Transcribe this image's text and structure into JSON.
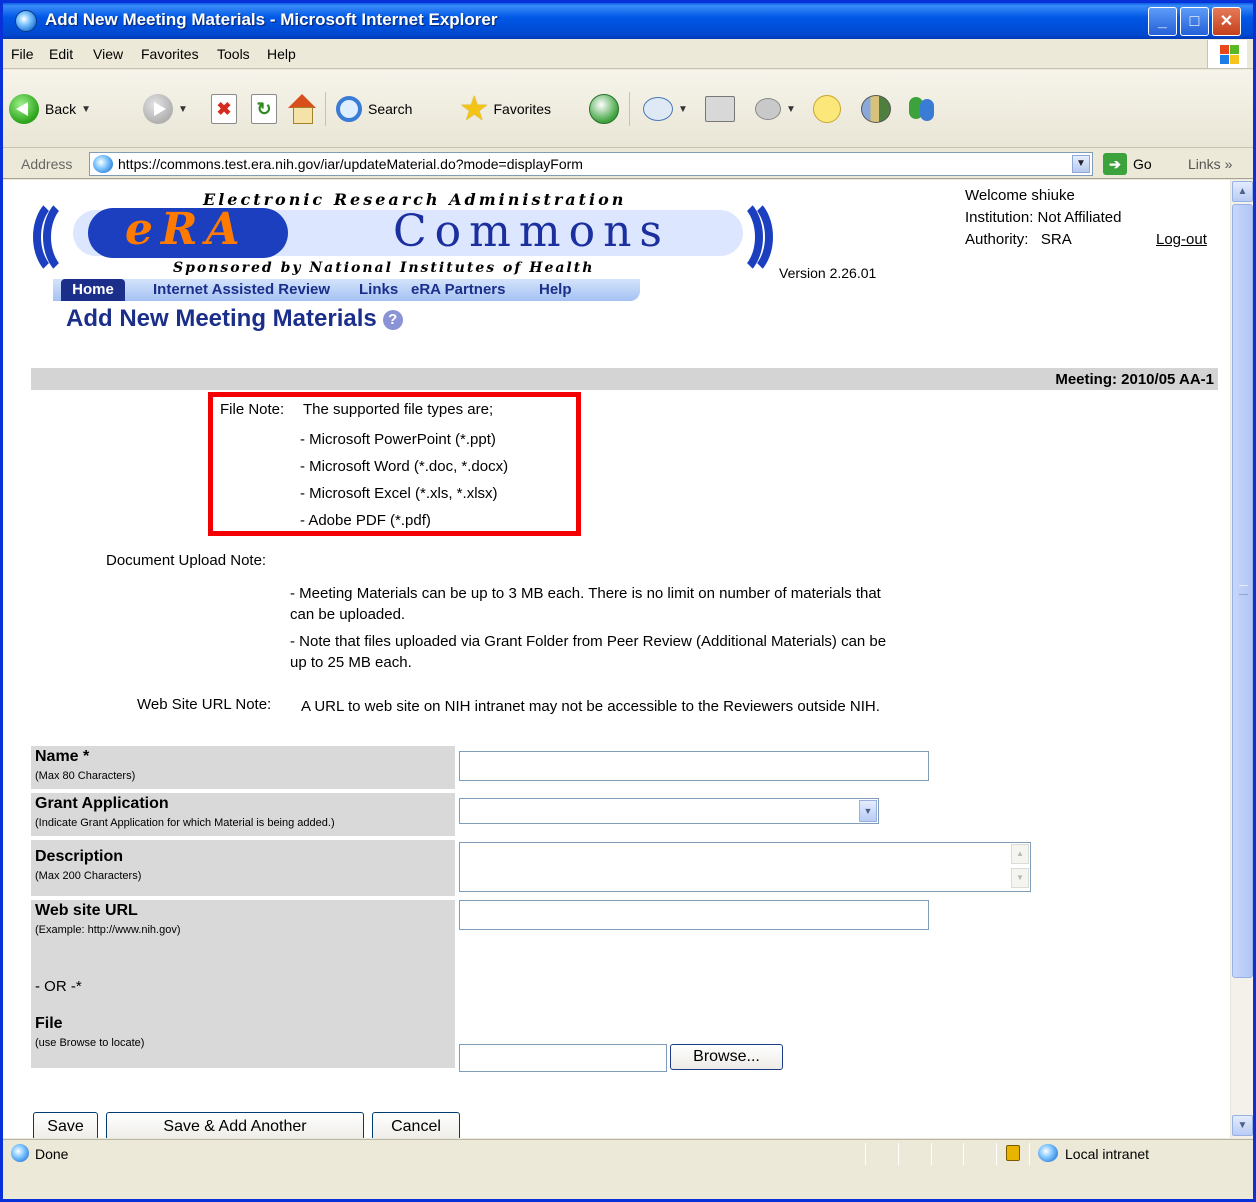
{
  "window": {
    "title": "Add New Meeting Materials - Microsoft Internet Explorer",
    "controls": [
      "_",
      "□",
      "✕"
    ]
  },
  "menu": [
    "File",
    "Edit",
    "View",
    "Favorites",
    "Tools",
    "Help"
  ],
  "toolbar": {
    "back_label": "Back",
    "search_label": "Search",
    "favorites_label": "Favorites"
  },
  "address": {
    "label": "Address",
    "url": "https://commons.test.era.nih.gov/iar/updateMaterial.do?mode=displayForm",
    "go_label": "Go",
    "links_label": "Links"
  },
  "logo": {
    "top_text": "Electronic Research Administration",
    "era_text": "eRA",
    "commons_text": "Commons",
    "bottom_text": "Sponsored by National Institutes of Health"
  },
  "version": "Version 2.26.01",
  "user": {
    "welcome_label": "Welcome",
    "welcome_name": "shiuke",
    "institution_label": "Institution:",
    "institution_value": "Not Affiliated",
    "authority_label": "Authority:",
    "authority_value": "SRA",
    "logout_label": "Log-out"
  },
  "nav": {
    "home": "Home",
    "items": [
      "Internet Assisted Review",
      "Links",
      "eRA Partners",
      "Help"
    ]
  },
  "page_title": "Add New Meeting Materials",
  "meeting_label": "Meeting: 2010/05 AA-1",
  "file_note": {
    "label": "File Note:",
    "intro": "The supported file types are;",
    "types": [
      "- Microsoft PowerPoint (*.ppt)",
      "- Microsoft Word (*.doc, *.docx)",
      "- Microsoft Excel (*.xls, *.xlsx)",
      "- Adobe PDF (*.pdf)"
    ]
  },
  "upload_note": {
    "label": "Document Upload Note:",
    "line1": "- Meeting Materials can be up to 3 MB each. There is no limit on number of materials that can be uploaded.",
    "line2": "- Note that files uploaded via Grant Folder from Peer Review (Additional Materials) can be up to 25 MB each."
  },
  "url_note": {
    "label": "Web Site URL Note:",
    "text": "A URL to web site on NIH intranet may not be accessible to the Reviewers outside NIH."
  },
  "form": {
    "name_label": "Name *",
    "name_sub": "(Max 80 Characters)",
    "name_value": "",
    "grant_label": "Grant Application",
    "grant_sub": "(Indicate Grant Application for which Material is being added.)",
    "grant_value": "",
    "desc_label": "Description",
    "desc_sub": "(Max 200 Characters)",
    "desc_value": "",
    "url_label": "Web site URL",
    "url_sub": "(Example: http://www.nih.gov)",
    "url_value": "",
    "or_label": "- OR -*",
    "file_label": "File",
    "file_sub": "(use Browse to locate)",
    "file_value": "",
    "browse_label": "Browse..."
  },
  "buttons": {
    "save": "Save",
    "save_add": "Save & Add Another",
    "cancel": "Cancel"
  },
  "status": {
    "text": "Done",
    "zone": "Local intranet"
  },
  "colors": {
    "title_bar": "#0058e6",
    "nav_dark": "#1b2f8a",
    "highlight_box": "#f30000",
    "label_cell": "#d9d9d9"
  }
}
